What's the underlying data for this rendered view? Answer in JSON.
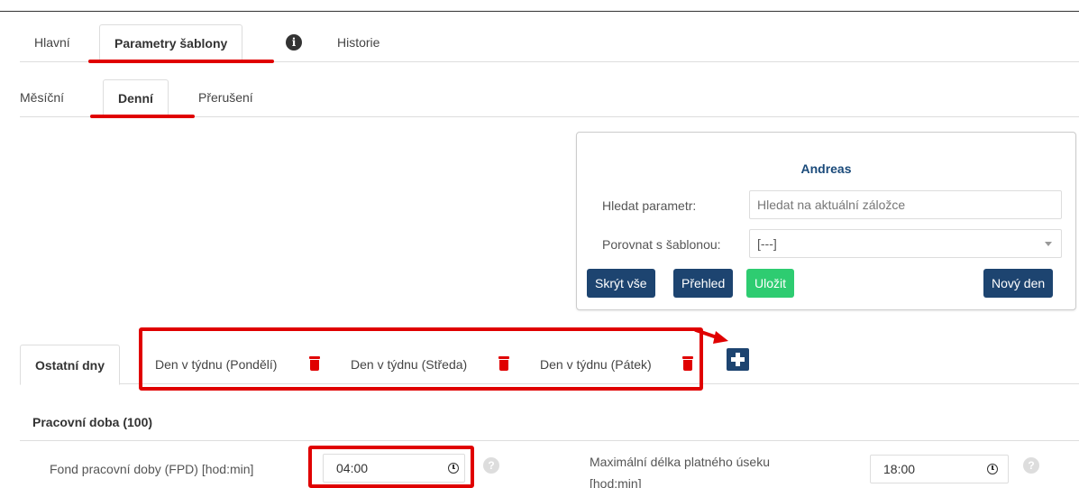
{
  "main_tabs": [
    {
      "label": "Hlavní"
    },
    {
      "label": "Parametry šablony"
    },
    {
      "label": "Historie"
    }
  ],
  "sub_tabs": [
    {
      "label": "Měsíční"
    },
    {
      "label": "Denní"
    },
    {
      "label": "Přerušení"
    }
  ],
  "panel": {
    "title": "Andreas",
    "search_label": "Hledat parametr:",
    "search_placeholder": "Hledat na aktuální záložce",
    "compare_label": "Porovnat s šablonou:",
    "compare_value": "[---]",
    "buttons": {
      "hide_all": "Skrýt vše",
      "overview": "Přehled",
      "save": "Uložit",
      "new_day": "Nový den"
    }
  },
  "day_tabs": [
    {
      "label": "Ostatní dny"
    },
    {
      "label": "Den v týdnu (Pondělí)"
    },
    {
      "label": "Den v týdnu (Středa)"
    },
    {
      "label": "Den v týdnu (Pátek)"
    }
  ],
  "section": {
    "title": "Pracovní doba (100)",
    "fields": [
      {
        "label": "Fond pracovní doby (FPD) [hod:min]",
        "value": "04:00"
      },
      {
        "label_line1": "Maximální délka platného úseku",
        "label_line2": "[hod:min]",
        "value": "18:00"
      }
    ]
  },
  "icons": {
    "info": "info-circle-icon",
    "trash": "trash-icon",
    "plus": "plus-square-icon",
    "clock": "clock-icon",
    "help": "question-circle-icon"
  },
  "colors": {
    "primary": "#1d4470",
    "success": "#2ecc71",
    "highlight": "#e00000",
    "title": "#1a4a7a"
  }
}
